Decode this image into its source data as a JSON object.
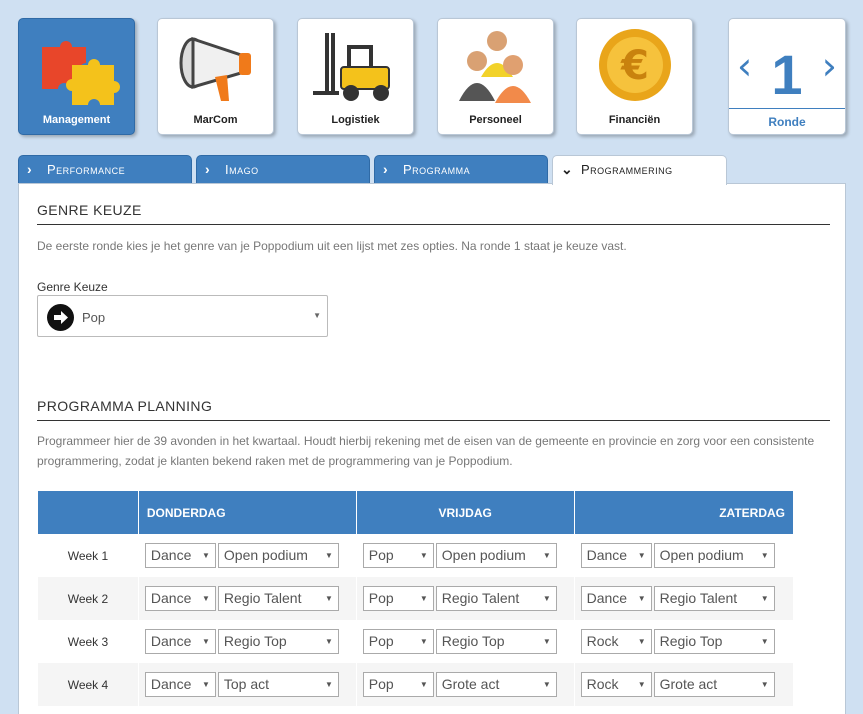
{
  "tiles": [
    {
      "label": "Management",
      "icon": "puzzle-icon"
    },
    {
      "label": "MarCom",
      "icon": "megaphone-icon"
    },
    {
      "label": "Logistiek",
      "icon": "forklift-icon"
    },
    {
      "label": "Personeel",
      "icon": "people-icon"
    },
    {
      "label": "Financiën",
      "icon": "euro-coin-icon"
    }
  ],
  "ronde": {
    "number": "1",
    "label": "Ronde",
    "prev": "‹",
    "next": "›"
  },
  "tabs": [
    {
      "label": "Performance",
      "chevron": "›"
    },
    {
      "label": "Imago",
      "chevron": "›"
    },
    {
      "label": "Programma",
      "chevron": "›"
    },
    {
      "label": "Programmering",
      "chevron": "⌄"
    }
  ],
  "genre": {
    "title": "GENRE KEUZE",
    "description": "De eerste ronde kies je het genre van je Poppodium uit een lijst met zes opties. Na ronde 1 staat je keuze vast.",
    "field_label": "Genre Keuze",
    "selected": "Pop"
  },
  "planning": {
    "title": "PROGRAMMA PLANNING",
    "description": "Programmeer hier de 39 avonden in het kwartaal. Houdt hierbij rekening met de eisen van de gemeente en provincie en zorg voor een consistente programmering, zodat je klanten bekend raken met de programmering van je Poppodium.",
    "columns": [
      "",
      "DONDERDAG",
      "VRIJDAG",
      "ZATERDAG"
    ],
    "rows": [
      {
        "week": "Week 1",
        "do": [
          "Dance",
          "Open podium"
        ],
        "vr": [
          "Pop",
          "Open podium"
        ],
        "za": [
          "Dance",
          "Open podium"
        ]
      },
      {
        "week": "Week 2",
        "do": [
          "Dance",
          "Regio Talent"
        ],
        "vr": [
          "Pop",
          "Regio Talent"
        ],
        "za": [
          "Dance",
          "Regio Talent"
        ]
      },
      {
        "week": "Week 3",
        "do": [
          "Dance",
          "Regio Top"
        ],
        "vr": [
          "Pop",
          "Regio Top"
        ],
        "za": [
          "Rock",
          "Regio Top"
        ]
      },
      {
        "week": "Week 4",
        "do": [
          "Dance",
          "Top act"
        ],
        "vr": [
          "Pop",
          "Grote act"
        ],
        "za": [
          "Rock",
          "Grote act"
        ]
      }
    ]
  },
  "colors": {
    "accent": "#3f7fbf",
    "background": "#cfe0f2"
  }
}
